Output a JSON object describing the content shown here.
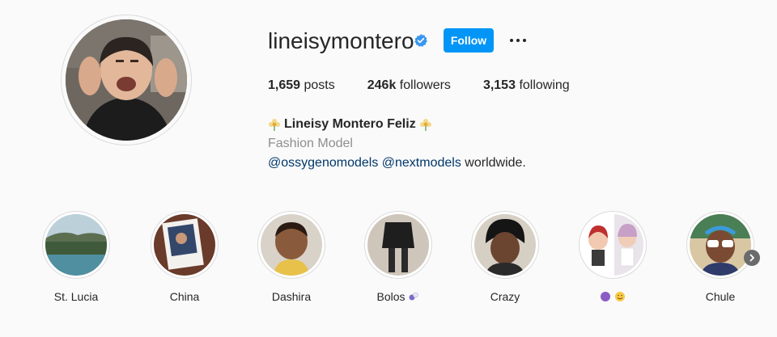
{
  "profile": {
    "username": "lineisymontero",
    "verified_icon": "verified-badge-icon",
    "follow_label": "Follow",
    "more_icon": "more-options-icon",
    "accent_color": "#0095f6"
  },
  "stats": {
    "posts_count": "1,659",
    "posts_label": "posts",
    "followers_count": "246k",
    "followers_label": "followers",
    "following_count": "3,153",
    "following_label": "following"
  },
  "bio": {
    "full_name": "Lineisy Montero Feliz",
    "category": "Fashion Model",
    "mention1": "@ossygenomodels",
    "mention2": "@nextmodels",
    "tail": "worldwide."
  },
  "highlights": [
    {
      "label": "St. Lucia"
    },
    {
      "label": "China"
    },
    {
      "label": "Dashira"
    },
    {
      "label": "Bolos"
    },
    {
      "label": "Crazy"
    },
    {
      "label": ""
    },
    {
      "label": "Chule"
    }
  ],
  "nav": {
    "next_icon": "chevron-right-icon"
  }
}
